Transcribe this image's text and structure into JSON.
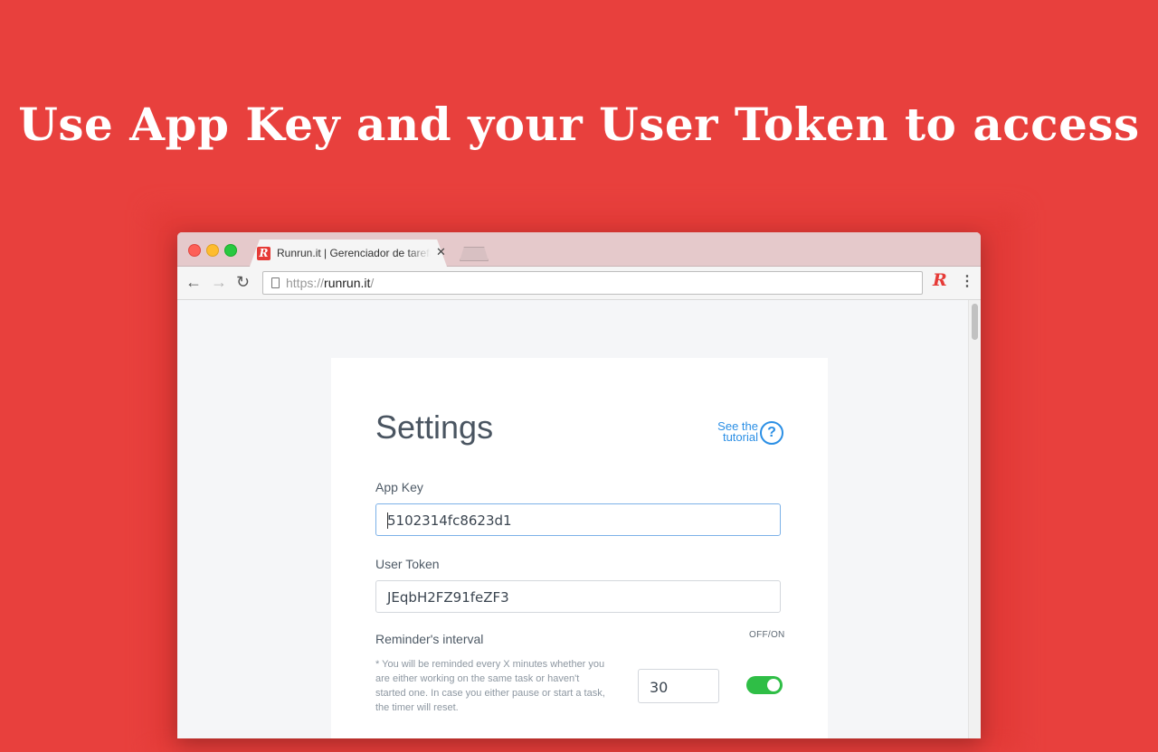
{
  "headline": "Use App Key and your User Token to access",
  "browser": {
    "tab": {
      "title": "Runrun.it | Gerenciador de tarefas",
      "favicon_letter": "R",
      "close_glyph": "✕"
    },
    "toolbar": {
      "back_glyph": "←",
      "forward_glyph": "→",
      "reload_glyph": "↻",
      "url_scheme": "https://",
      "url_host": "runrun.it",
      "url_path": "/",
      "extension_letter": "R",
      "menu_glyph": "⋮"
    }
  },
  "settings": {
    "title": "Settings",
    "tutorial_line1": "See the",
    "tutorial_line2": "tutorial",
    "help_glyph": "?",
    "app_key_label": "App Key",
    "app_key_value": "5102314fc8623d1",
    "user_token_label": "User Token",
    "user_token_value": "JEqbH2FZ91feZF3",
    "reminder_label": "Reminder's interval",
    "toggle_label": "OFF/ON",
    "reminder_hint": "* You will be reminded every X minutes whether you are either working on the same task or haven't started one. In case you either pause or start a task, the timer will reset.",
    "interval_minutes": "30",
    "reminder_enabled": true
  },
  "colors": {
    "background": "#e8403d",
    "accent_blue": "#2b8fe5",
    "toggle_green": "#2fbe46",
    "brand_red": "#e63b37"
  },
  "icons": [
    "close-icon",
    "back-arrow-icon",
    "forward-arrow-icon",
    "reload-icon",
    "page-icon",
    "runrun-extension-icon",
    "menu-dots-icon",
    "help-icon"
  ]
}
